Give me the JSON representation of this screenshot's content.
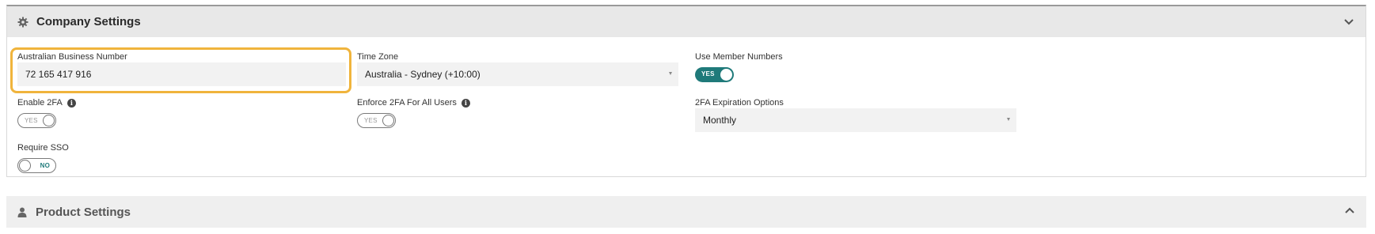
{
  "company": {
    "title": "Company Settings",
    "icon": "gear-icon",
    "toggle_icon": "chevron-down-icon",
    "abn": {
      "label": "Australian Business Number",
      "value": "72 165 417 916"
    },
    "timezone": {
      "label": "Time Zone",
      "value": "Australia - Sydney (+10:00)"
    },
    "member_numbers": {
      "label": "Use Member Numbers",
      "state": "YES",
      "on": true
    },
    "enable_2fa": {
      "label": "Enable 2FA",
      "state": "YES",
      "on": false
    },
    "enforce_2fa": {
      "label": "Enforce 2FA For All Users",
      "state": "YES",
      "on": false
    },
    "expiration": {
      "label": "2FA Expiration Options",
      "value": "Monthly"
    },
    "require_sso": {
      "label": "Require SSO",
      "state": "NO",
      "on": false
    }
  },
  "product": {
    "title": "Product Settings",
    "icon": "user-icon",
    "toggle_icon": "chevron-up-icon"
  },
  "colors": {
    "accent": "#1f7a7a",
    "highlight": "#f0b43c"
  }
}
